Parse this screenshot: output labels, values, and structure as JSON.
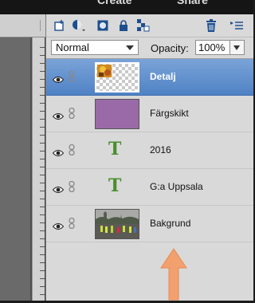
{
  "menu": {
    "items": [
      "Create",
      "Share"
    ]
  },
  "toolbar": {
    "icons": [
      "new-layer-icon",
      "fill-adjustment-icon",
      "mask-icon",
      "lock-icon",
      "lock-transparency-icon",
      "trash-icon",
      "panel-menu-icon"
    ]
  },
  "controls": {
    "blend_mode": "Normal",
    "opacity_label": "Opacity:",
    "opacity_value": "100%"
  },
  "layers": [
    {
      "name": "Detalj",
      "type": "image",
      "selected": true
    },
    {
      "name": "Färgskikt",
      "type": "fill",
      "color": "#9a6aa8",
      "selected": false
    },
    {
      "name": "2016",
      "type": "text",
      "icon": "T",
      "selected": false
    },
    {
      "name": "G:a Uppsala",
      "type": "text",
      "icon": "T",
      "selected": false
    },
    {
      "name": "Bakgrund",
      "type": "image",
      "selected": false
    }
  ],
  "colors": {
    "selection": "#5a8bcb",
    "text_layer_icon": "#4a8f2e",
    "arrow": "#f2a06e"
  }
}
